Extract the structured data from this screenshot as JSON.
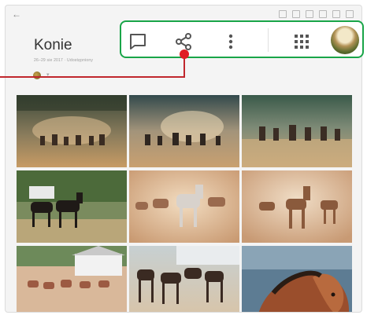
{
  "album": {
    "title": "Konie",
    "meta": "26–29 sie 2017 · Udostępniony"
  },
  "toolbar": {
    "comment_icon": "comment-icon",
    "share_icon": "share-icon",
    "more_icon": "more-vert-icon",
    "apps_icon": "apps-grid-icon",
    "account_icon": "account-avatar"
  },
  "colors": {
    "highlight_border": "#19a548",
    "pointer": "#e01e24",
    "title_text": "#333333"
  },
  "photos": [
    {
      "name": "photo-horses-forest-trail"
    },
    {
      "name": "photo-horses-herd-backlit"
    },
    {
      "name": "photo-horses-paddock-running"
    },
    {
      "name": "photo-two-dark-horses"
    },
    {
      "name": "photo-horses-dust-grey"
    },
    {
      "name": "photo-horses-dust-chestnut"
    },
    {
      "name": "photo-horses-stable-building"
    },
    {
      "name": "photo-horses-dark-herd"
    },
    {
      "name": "photo-horse-portrait-chestnut"
    }
  ]
}
